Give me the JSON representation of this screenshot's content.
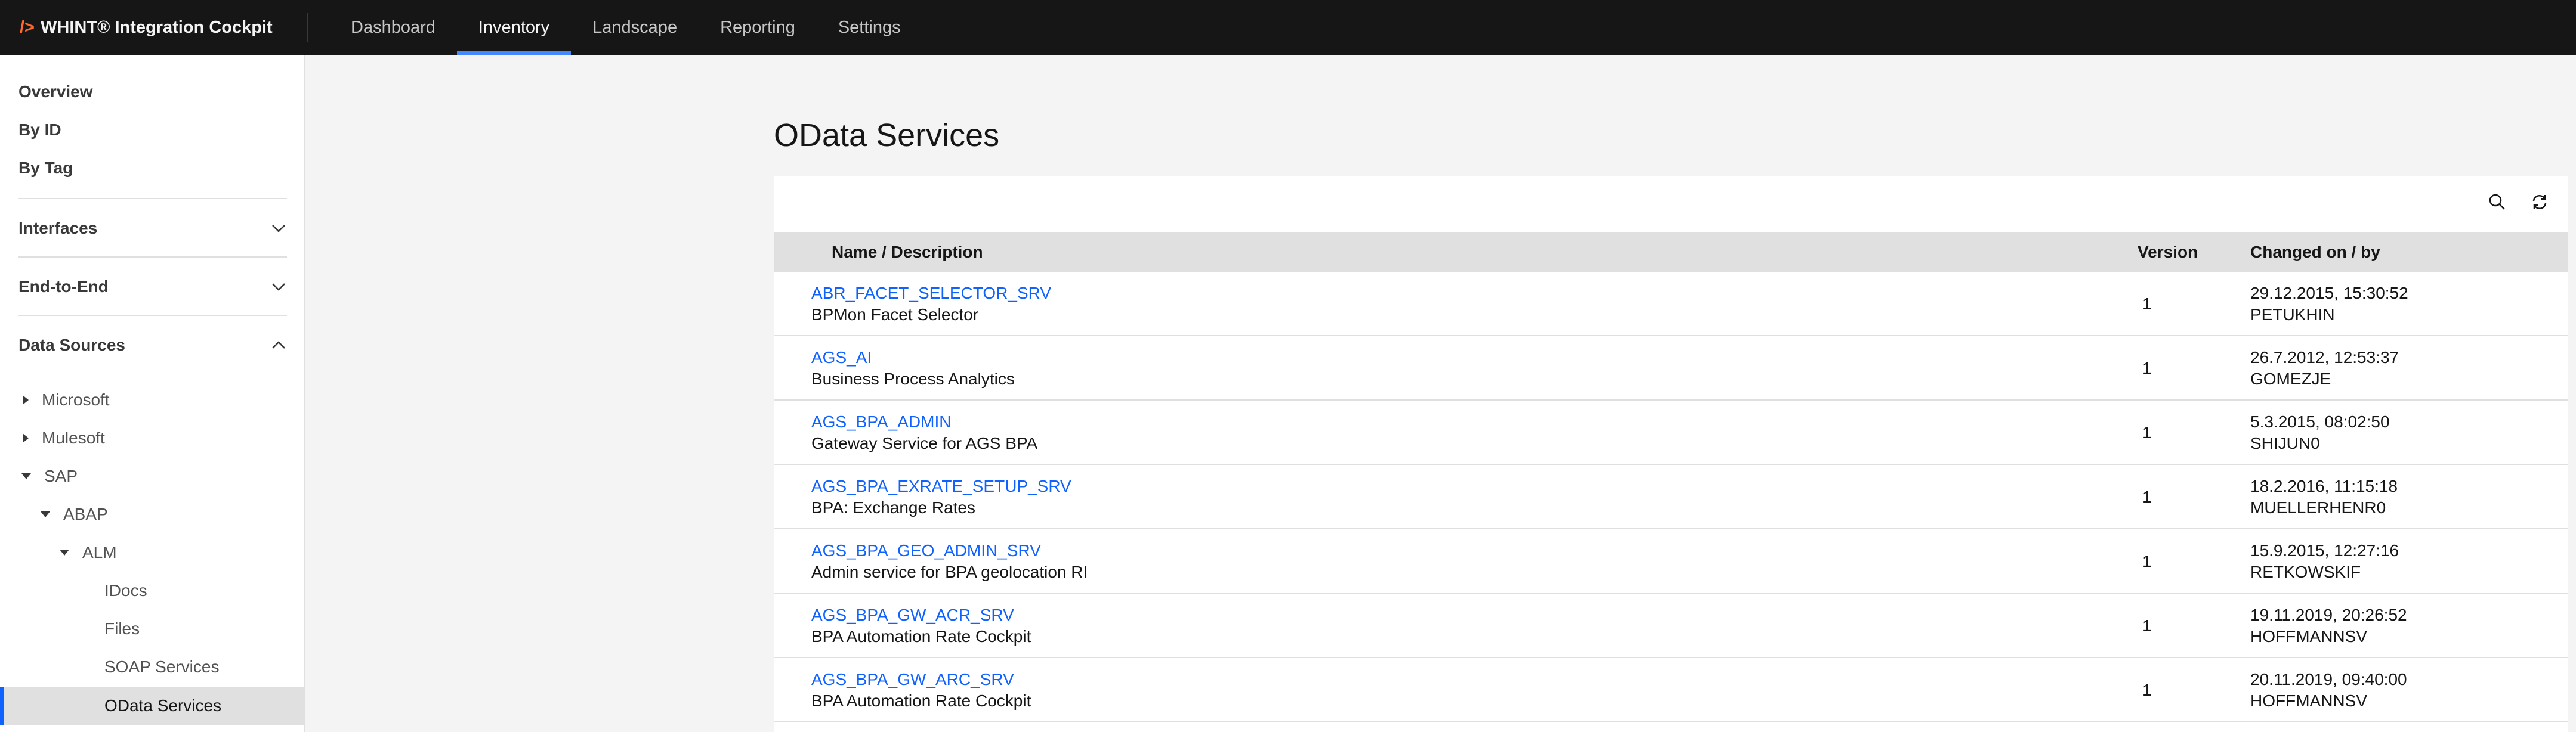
{
  "app": {
    "logo_mark": "/>",
    "title": "WHINT® Integration Cockpit"
  },
  "nav": [
    {
      "label": "Dashboard"
    },
    {
      "label": "Inventory"
    },
    {
      "label": "Landscape"
    },
    {
      "label": "Reporting"
    },
    {
      "label": "Settings"
    }
  ],
  "sidebar": {
    "quick_links": [
      "Overview",
      "By ID",
      "By Tag"
    ],
    "sections": [
      {
        "label": "Interfaces",
        "state": "collapsed"
      },
      {
        "label": "End-to-End",
        "state": "collapsed"
      },
      {
        "label": "Data Sources",
        "state": "expanded"
      }
    ],
    "tree": {
      "microsoft": "Microsoft",
      "mulesoft": "Mulesoft",
      "sap": "SAP",
      "abap": "ABAP",
      "alm": "ALM",
      "idocs": "IDocs",
      "files": "Files",
      "soap": "SOAP Services",
      "odata": "OData Services"
    }
  },
  "main": {
    "title": "OData Services",
    "toolbar": {
      "search_icon": "search-icon",
      "refresh_icon": "refresh-icon"
    },
    "columns": {
      "name": "Name / Description",
      "version": "Version",
      "changed": "Changed on / by"
    },
    "rows": [
      {
        "name": "ABR_FACET_SELECTOR_SRV",
        "desc": "BPMon Facet Selector",
        "version": "1",
        "changed_on": "29.12.2015, 15:30:52",
        "changed_by": "PETUKHIN"
      },
      {
        "name": "AGS_AI",
        "desc": "Business Process Analytics",
        "version": "1",
        "changed_on": "26.7.2012, 12:53:37",
        "changed_by": "GOMEZJE"
      },
      {
        "name": "AGS_BPA_ADMIN",
        "desc": "Gateway Service for AGS BPA",
        "version": "1",
        "changed_on": "5.3.2015, 08:02:50",
        "changed_by": "SHIJUN0"
      },
      {
        "name": "AGS_BPA_EXRATE_SETUP_SRV",
        "desc": "BPA: Exchange Rates",
        "version": "1",
        "changed_on": "18.2.2016, 11:15:18",
        "changed_by": "MUELLERHENR0"
      },
      {
        "name": "AGS_BPA_GEO_ADMIN_SRV",
        "desc": "Admin service for BPA geolocation RI",
        "version": "1",
        "changed_on": "15.9.2015, 12:27:16",
        "changed_by": "RETKOWSKIF"
      },
      {
        "name": "AGS_BPA_GW_ACR_SRV",
        "desc": "BPA Automation Rate Cockpit",
        "version": "1",
        "changed_on": "19.11.2019, 20:26:52",
        "changed_by": "HOFFMANNSV"
      },
      {
        "name": "AGS_BPA_GW_ARC_SRV",
        "desc": "BPA Automation Rate Cockpit",
        "version": "1",
        "changed_on": "20.11.2019, 09:40:00",
        "changed_by": "HOFFMANNSV"
      }
    ]
  },
  "colors": {
    "topbar": "#161616",
    "accent": "#0f62fe",
    "nav_active": "#4589ff",
    "logo": "#ff6a2b"
  }
}
